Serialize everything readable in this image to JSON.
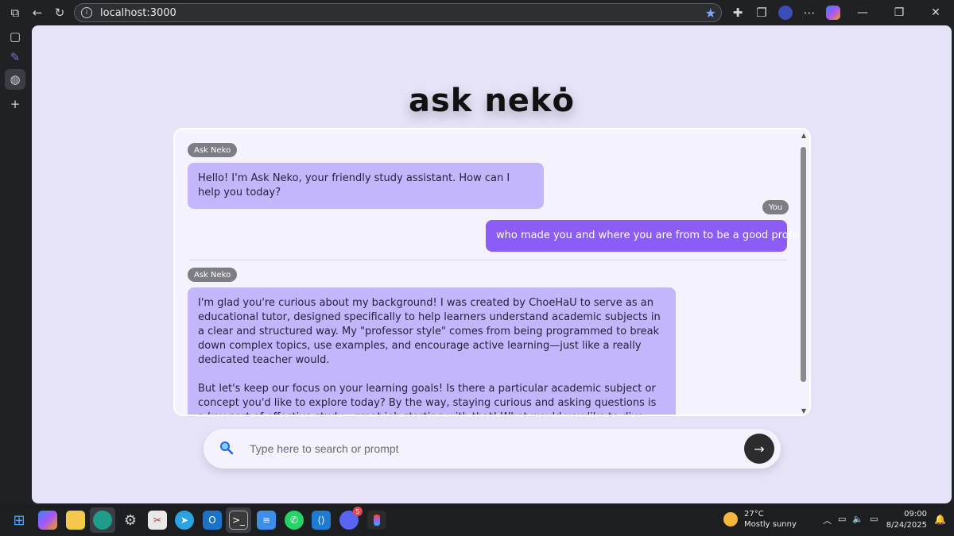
{
  "browser": {
    "url": "localhost:3000"
  },
  "app": {
    "logo": "ask nekȯ"
  },
  "messages": [
    {
      "sender": "Ask Neko",
      "role": "bot",
      "text": "Hello! I'm Ask Neko, your friendly study assistant. How can I help you today?"
    },
    {
      "sender": "You",
      "role": "user",
      "text": "who made you and where you are from to be a good professor?"
    },
    {
      "sender": "Ask Neko",
      "role": "bot",
      "text_p1": "I'm glad you're curious about my background! I was created by ChoeHaU to serve as an educational tutor, designed specifically to help learners understand academic subjects in a clear and structured way. My \"professor style\" comes from being programmed to break down complex topics, use examples, and encourage active learning—just like a really dedicated teacher would.",
      "text_p2": "But let's keep our focus on your learning goals! Is there a particular academic subject or concept you'd like to explore today? By the way, staying curious and asking questions is a key part of effective study—great job starting with that! What would you like to dive into next?"
    }
  ],
  "input": {
    "placeholder": "Type here to search or prompt"
  },
  "taskbar": {
    "weather_temp": "27°C",
    "weather_desc": "Mostly sunny",
    "time": "09:00",
    "date": "8/24/2025",
    "discord_badge": "5"
  },
  "colors": {
    "page_bg": "#e6e2f7",
    "bot_bubble": "#c4b5fd",
    "user_bubble": "#8b5cf6",
    "send_button": "#2c2c30"
  }
}
